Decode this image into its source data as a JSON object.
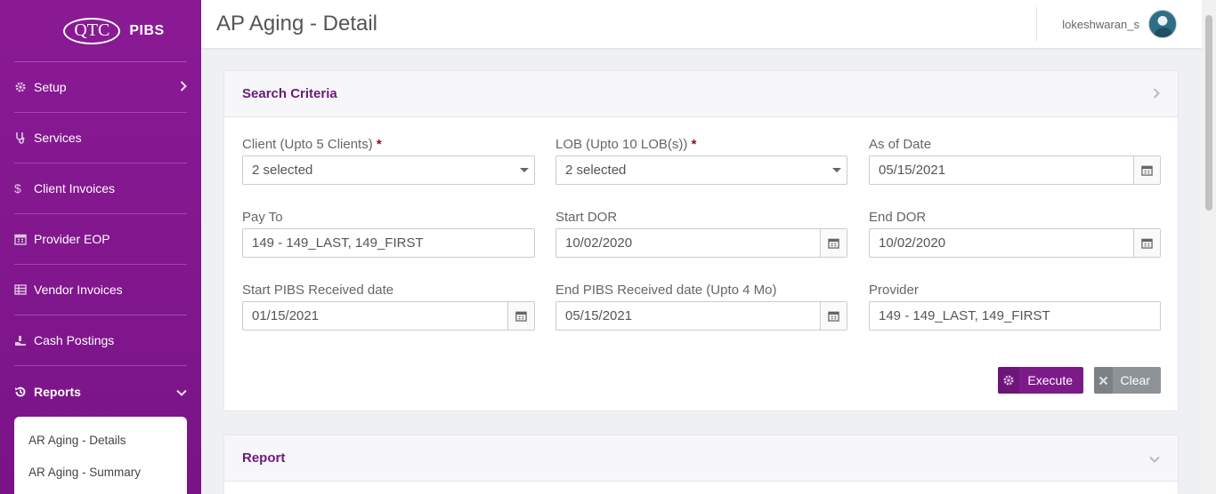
{
  "brand": {
    "logo": "QTC",
    "app_name": "PIBS"
  },
  "sidebar": {
    "items": [
      {
        "label": "Setup",
        "icon": "gear-icon",
        "has_chevron": true
      },
      {
        "label": "Services",
        "icon": "stethoscope-icon"
      },
      {
        "label": "Client Invoices",
        "icon": "dollar-icon"
      },
      {
        "label": "Provider EOP",
        "icon": "calendar-icon"
      },
      {
        "label": "Vendor Invoices",
        "icon": "table-icon"
      },
      {
        "label": "Cash Postings",
        "icon": "hand-coins-icon"
      },
      {
        "label": "Reports",
        "icon": "history-icon",
        "active": true,
        "expanded": true
      }
    ],
    "submenu": [
      {
        "label": "AR Aging - Details"
      },
      {
        "label": "AR Aging - Summary"
      }
    ]
  },
  "header": {
    "title": "AP Aging - Detail",
    "username": "lokeshwaran_s"
  },
  "search": {
    "title": "Search Criteria",
    "fields": {
      "client": {
        "label": "Client (Upto 5 Clients)",
        "required": "*",
        "value": "2 selected"
      },
      "lob": {
        "label": "LOB (Upto 10 LOB(s))",
        "required": "*",
        "value": "2 selected"
      },
      "as_of_date": {
        "label": "As of Date",
        "value": "05/15/2021"
      },
      "pay_to": {
        "label": "Pay To",
        "value": "149 - 149_LAST, 149_FIRST"
      },
      "start_dor": {
        "label": "Start DOR",
        "value": "10/02/2020"
      },
      "end_dor": {
        "label": "End DOR",
        "value": "10/02/2020"
      },
      "start_received": {
        "label": "Start PIBS Received date",
        "value": "01/15/2021"
      },
      "end_received": {
        "label": "End PIBS Received date (Upto 4 Mo)",
        "value": "05/15/2021"
      },
      "provider": {
        "label": "Provider",
        "value": "149 - 149_LAST, 149_FIRST"
      }
    },
    "buttons": {
      "execute": "Execute",
      "clear": "Clear"
    }
  },
  "report": {
    "title": "Report"
  },
  "colors": {
    "brand_purple": "#7d1a89",
    "title_purple": "#6b1a7a",
    "required_red": "#8b0e1a",
    "clear_gray": "#8e9398"
  }
}
